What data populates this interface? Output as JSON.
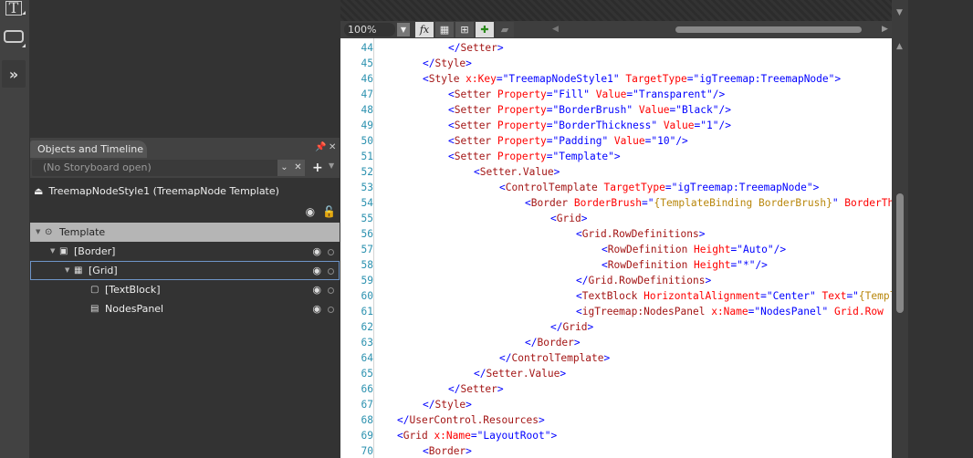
{
  "toolstrip": {
    "tools": [
      {
        "name": "text-tool"
      },
      {
        "name": "direct-select-tool"
      },
      {
        "name": "expand-assets"
      }
    ]
  },
  "objects_panel": {
    "title": "Objects and Timeline",
    "storyboard_placeholder": "(No Storyboard open)",
    "scope": "TreemapNodeStyle1 (TreemapNode Template)",
    "tree": [
      {
        "label": "Template",
        "level": 0,
        "icon": "template-icon",
        "expanded": true,
        "root": true
      },
      {
        "label": "[Border]",
        "level": 1,
        "icon": "border-icon",
        "expanded": true
      },
      {
        "label": "[Grid]",
        "level": 2,
        "icon": "grid-icon",
        "expanded": true,
        "selected": true
      },
      {
        "label": "[TextBlock]",
        "level": 3,
        "icon": "textblock-icon"
      },
      {
        "label": "NodesPanel",
        "level": 3,
        "icon": "panel-icon"
      }
    ]
  },
  "editor": {
    "zoom": "100%",
    "lines": [
      {
        "n": "44",
        "indent": 4,
        "parts": [
          [
            "p",
            "</"
          ],
          [
            "t",
            "Setter"
          ],
          [
            "p",
            ">"
          ]
        ]
      },
      {
        "n": "45",
        "indent": 3,
        "parts": [
          [
            "p",
            "</"
          ],
          [
            "t",
            "Style"
          ],
          [
            "p",
            ">"
          ]
        ]
      },
      {
        "n": "46",
        "indent": 3,
        "parts": [
          [
            "p",
            "<"
          ],
          [
            "t",
            "Style"
          ],
          [
            "a",
            " x:Key"
          ],
          [
            "p",
            "=\""
          ],
          [
            "s",
            "TreemapNodeStyle1"
          ],
          [
            "p",
            "\""
          ],
          [
            "a",
            " TargetType"
          ],
          [
            "p",
            "=\""
          ],
          [
            "s",
            "igTreemap:TreemapNode"
          ],
          [
            "p",
            "\">"
          ]
        ]
      },
      {
        "n": "47",
        "indent": 4,
        "parts": [
          [
            "p",
            "<"
          ],
          [
            "t",
            "Setter"
          ],
          [
            "a",
            " Property"
          ],
          [
            "p",
            "=\""
          ],
          [
            "s",
            "Fill"
          ],
          [
            "p",
            "\""
          ],
          [
            "a",
            " Value"
          ],
          [
            "p",
            "=\""
          ],
          [
            "s",
            "Transparent"
          ],
          [
            "p",
            "\"/>"
          ]
        ]
      },
      {
        "n": "48",
        "indent": 4,
        "parts": [
          [
            "p",
            "<"
          ],
          [
            "t",
            "Setter"
          ],
          [
            "a",
            " Property"
          ],
          [
            "p",
            "=\""
          ],
          [
            "s",
            "BorderBrush"
          ],
          [
            "p",
            "\""
          ],
          [
            "a",
            " Value"
          ],
          [
            "p",
            "=\""
          ],
          [
            "s",
            "Black"
          ],
          [
            "p",
            "\"/>"
          ]
        ]
      },
      {
        "n": "49",
        "indent": 4,
        "parts": [
          [
            "p",
            "<"
          ],
          [
            "t",
            "Setter"
          ],
          [
            "a",
            " Property"
          ],
          [
            "p",
            "=\""
          ],
          [
            "s",
            "BorderThickness"
          ],
          [
            "p",
            "\""
          ],
          [
            "a",
            " Value"
          ],
          [
            "p",
            "=\""
          ],
          [
            "s",
            "1"
          ],
          [
            "p",
            "\"/>"
          ]
        ]
      },
      {
        "n": "50",
        "indent": 4,
        "parts": [
          [
            "p",
            "<"
          ],
          [
            "t",
            "Setter"
          ],
          [
            "a",
            " Property"
          ],
          [
            "p",
            "=\""
          ],
          [
            "s",
            "Padding"
          ],
          [
            "p",
            "\""
          ],
          [
            "a",
            " Value"
          ],
          [
            "p",
            "=\""
          ],
          [
            "s",
            "10"
          ],
          [
            "p",
            "\"/>"
          ]
        ]
      },
      {
        "n": "51",
        "indent": 4,
        "parts": [
          [
            "p",
            "<"
          ],
          [
            "t",
            "Setter"
          ],
          [
            "a",
            " Property"
          ],
          [
            "p",
            "=\""
          ],
          [
            "s",
            "Template"
          ],
          [
            "p",
            "\">"
          ]
        ]
      },
      {
        "n": "52",
        "indent": 5,
        "parts": [
          [
            "p",
            "<"
          ],
          [
            "t",
            "Setter.Value"
          ],
          [
            "p",
            ">"
          ]
        ]
      },
      {
        "n": "53",
        "indent": 6,
        "parts": [
          [
            "p",
            "<"
          ],
          [
            "t",
            "ControlTemplate"
          ],
          [
            "a",
            " TargetType"
          ],
          [
            "p",
            "=\""
          ],
          [
            "s",
            "igTreemap:TreemapNode"
          ],
          [
            "p",
            "\">"
          ]
        ]
      },
      {
        "n": "54",
        "indent": 7,
        "parts": [
          [
            "p",
            "<"
          ],
          [
            "t",
            "Border"
          ],
          [
            "a",
            " BorderBrush"
          ],
          [
            "p",
            "=\""
          ],
          [
            "b",
            "{TemplateBinding BorderBrush}"
          ],
          [
            "p",
            "\""
          ],
          [
            "a",
            " BorderThickness"
          ]
        ]
      },
      {
        "n": "55",
        "indent": 8,
        "parts": [
          [
            "p",
            "<"
          ],
          [
            "t",
            "Grid"
          ],
          [
            "p",
            ">"
          ]
        ]
      },
      {
        "n": "56",
        "indent": 9,
        "parts": [
          [
            "p",
            "<"
          ],
          [
            "t",
            "Grid.RowDefinitions"
          ],
          [
            "p",
            ">"
          ]
        ]
      },
      {
        "n": "57",
        "indent": 10,
        "parts": [
          [
            "p",
            "<"
          ],
          [
            "t",
            "RowDefinition"
          ],
          [
            "a",
            " Height"
          ],
          [
            "p",
            "=\""
          ],
          [
            "s",
            "Auto"
          ],
          [
            "p",
            "\"/>"
          ]
        ]
      },
      {
        "n": "58",
        "indent": 10,
        "parts": [
          [
            "p",
            "<"
          ],
          [
            "t",
            "RowDefinition"
          ],
          [
            "a",
            " Height"
          ],
          [
            "p",
            "=\""
          ],
          [
            "s",
            "*"
          ],
          [
            "p",
            "\"/>"
          ]
        ]
      },
      {
        "n": "59",
        "indent": 9,
        "parts": [
          [
            "p",
            "</"
          ],
          [
            "t",
            "Grid.RowDefinitions"
          ],
          [
            "p",
            ">"
          ]
        ]
      },
      {
        "n": "60",
        "indent": 9,
        "parts": [
          [
            "p",
            "<"
          ],
          [
            "t",
            "TextBlock"
          ],
          [
            "a",
            " HorizontalAlignment"
          ],
          [
            "p",
            "=\""
          ],
          [
            "s",
            "Center"
          ],
          [
            "p",
            "\""
          ],
          [
            "a",
            " Text"
          ],
          [
            "p",
            "=\""
          ],
          [
            "b",
            "{TemplateBinding Text}"
          ]
        ]
      },
      {
        "n": "61",
        "indent": 9,
        "parts": [
          [
            "p",
            "<"
          ],
          [
            "t",
            "igTreemap:NodesPanel"
          ],
          [
            "a",
            " x:Name"
          ],
          [
            "p",
            "=\""
          ],
          [
            "s",
            "NodesPanel"
          ],
          [
            "p",
            "\""
          ],
          [
            "a",
            " Grid.Row"
          ]
        ]
      },
      {
        "n": "62",
        "indent": 8,
        "parts": [
          [
            "p",
            "</"
          ],
          [
            "t",
            "Grid"
          ],
          [
            "p",
            ">"
          ]
        ]
      },
      {
        "n": "63",
        "indent": 7,
        "parts": [
          [
            "p",
            "</"
          ],
          [
            "t",
            "Border"
          ],
          [
            "p",
            ">"
          ]
        ]
      },
      {
        "n": "64",
        "indent": 6,
        "parts": [
          [
            "p",
            "</"
          ],
          [
            "t",
            "ControlTemplate"
          ],
          [
            "p",
            ">"
          ]
        ]
      },
      {
        "n": "65",
        "indent": 5,
        "parts": [
          [
            "p",
            "</"
          ],
          [
            "t",
            "Setter.Value"
          ],
          [
            "p",
            ">"
          ]
        ]
      },
      {
        "n": "66",
        "indent": 4,
        "parts": [
          [
            "p",
            "</"
          ],
          [
            "t",
            "Setter"
          ],
          [
            "p",
            ">"
          ]
        ]
      },
      {
        "n": "67",
        "indent": 3,
        "parts": [
          [
            "p",
            "</"
          ],
          [
            "t",
            "Style"
          ],
          [
            "p",
            ">"
          ]
        ]
      },
      {
        "n": "68",
        "indent": 2,
        "parts": [
          [
            "p",
            "</"
          ],
          [
            "t",
            "UserControl.Resources"
          ],
          [
            "p",
            ">"
          ]
        ]
      },
      {
        "n": "69",
        "indent": 2,
        "parts": [
          [
            "p",
            "<"
          ],
          [
            "t",
            "Grid"
          ],
          [
            "a",
            " x:Name"
          ],
          [
            "p",
            "=\""
          ],
          [
            "s",
            "LayoutRoot"
          ],
          [
            "p",
            "\">"
          ]
        ]
      },
      {
        "n": "70",
        "indent": 3,
        "parts": [
          [
            "p",
            "<"
          ],
          [
            "t",
            "Border"
          ],
          [
            "p",
            ">"
          ]
        ]
      }
    ]
  }
}
